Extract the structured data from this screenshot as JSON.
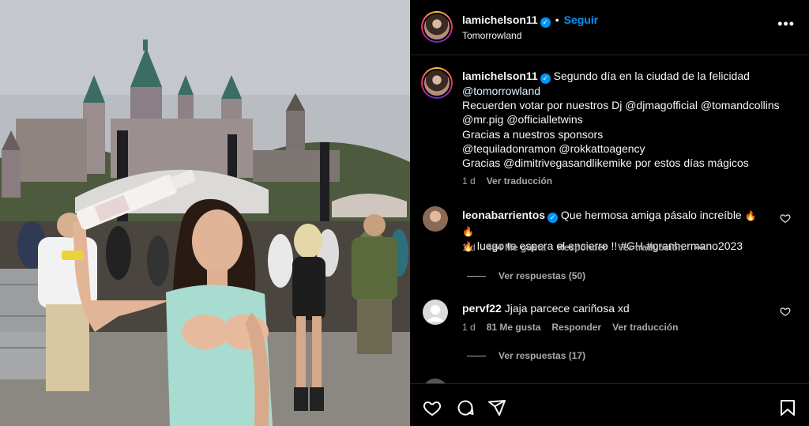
{
  "header": {
    "username": "lamichelson11",
    "follow_label": "Seguir",
    "separator": "•",
    "location": "Tomorrowland",
    "more_label": "•••"
  },
  "caption": {
    "username": "lamichelson11",
    "lines": [
      "Segundo día en la ciudad de la felicidad",
      "@tomorrowland",
      "Recuerden votar por nuestros Dj @djmagofficial @tomandcollins",
      "@mr.pig @officialletwins",
      "Gracias a nuestros sponsors",
      "@tequiladonramon @rokkattoagency",
      "Gracias @dimitrivegasandlikemike por estos días mágicos"
    ],
    "time": "1 d",
    "translate": "Ver traducción"
  },
  "comments": [
    {
      "username": "leonabarrientos",
      "verified": true,
      "text_line1": "Que hermosa amiga pásalo increíble",
      "text_line2": "luego te espera el encierro !! #GH #granhermano2023",
      "time": "1 d",
      "likes": "484 Me gusta",
      "reply": "Responder",
      "translate": "Ver traducción",
      "more": "•••",
      "view_replies": "Ver respuestas (50)"
    },
    {
      "username": "pervf22",
      "verified": false,
      "text_line1": "Jjaja parcece cariñosa xd",
      "time": "1 d",
      "likes": "81 Me gusta",
      "reply": "Responder",
      "translate": "Ver traducción",
      "view_replies": "Ver respuestas (17)"
    }
  ],
  "icons": {
    "like": "heart-icon",
    "comment": "comment-icon",
    "share": "share-icon",
    "save": "bookmark-icon"
  },
  "colors": {
    "accent": "#0095f6",
    "background": "#000000",
    "text": "#f5f5f5",
    "muted": "#a8a8a8"
  }
}
